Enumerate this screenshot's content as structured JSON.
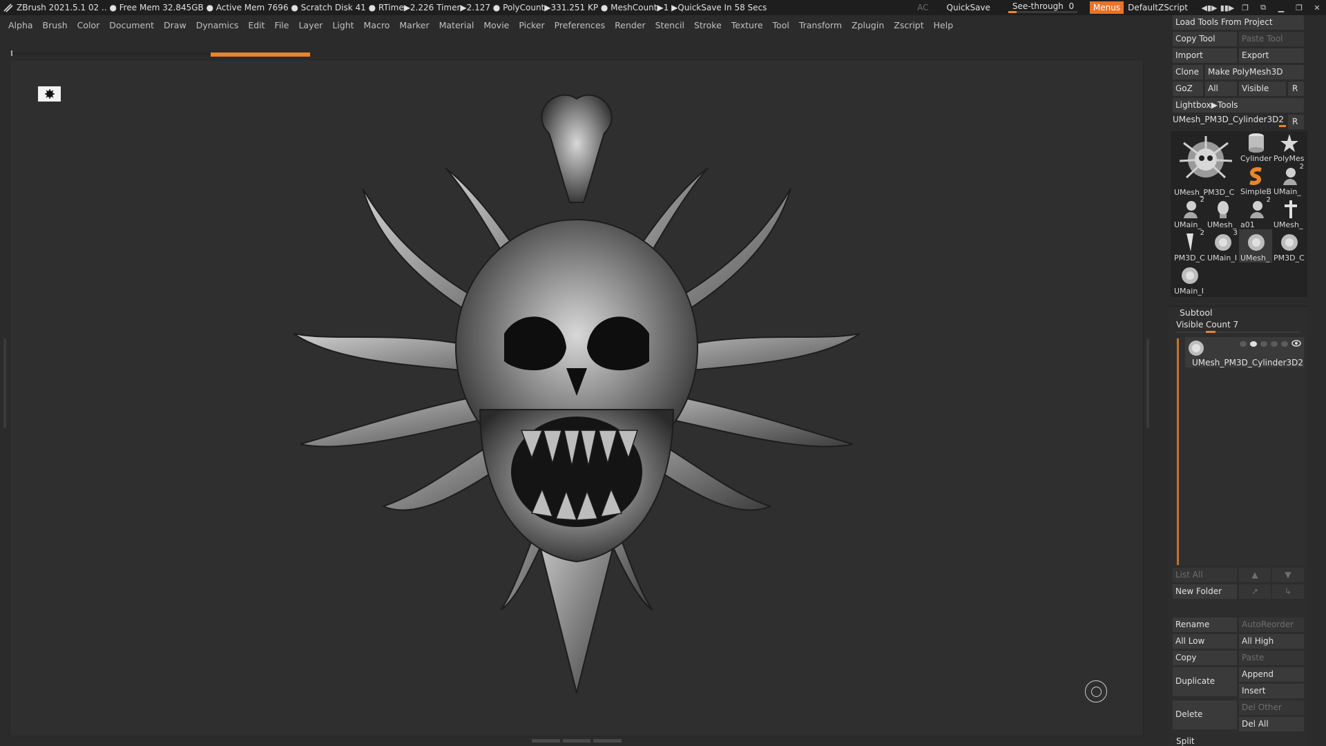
{
  "titlebar": {
    "status": "ZBrush 2021.5.1   02  .. ● Free Mem 32.845GB ● Active Mem 7696 ● Scratch Disk 41 ●  RTime▶2.226 Timer▶2.127 ● PolyCount▶331.251 KP  ● MeshCount▶1  ▶QuickSave In 58 Secs",
    "ac": "AC",
    "quicksave": "QuickSave",
    "seethrough_label": "See-through",
    "seethrough_value": "0",
    "menus": "Menus",
    "script": "DefaultZScript"
  },
  "menubar": {
    "items": [
      "Alpha",
      "Brush",
      "Color",
      "Document",
      "Draw",
      "Dynamics",
      "Edit",
      "File",
      "Layer",
      "Light",
      "Macro",
      "Marker",
      "Material",
      "Movie",
      "Picker",
      "Preferences",
      "Render",
      "Stencil",
      "Stroke",
      "Texture",
      "Tool",
      "Transform",
      "Zplugin",
      "Zscript",
      "Help"
    ]
  },
  "tool_panel": {
    "load_tools": "Load Tools From Project",
    "copy_tool": "Copy Tool",
    "paste_tool": "Paste Tool",
    "import": "Import",
    "export": "Export",
    "clone": "Clone",
    "make_polymesh": "Make PolyMesh3D",
    "goz": "GoZ",
    "all": "All",
    "visible": "Visible",
    "r": "R",
    "lightbox_tools": "Lightbox▶Tools",
    "current_tool": "UMesh_PM3D_Cylinder3D2",
    "tools": [
      {
        "label": "UMesh_PM3D_C",
        "count": ""
      },
      {
        "label": "Cylinder",
        "count": ""
      },
      {
        "label": "PolyMes",
        "count": ""
      },
      {
        "label": "SimpleB",
        "count": ""
      },
      {
        "label": "UMain_",
        "count": "2"
      },
      {
        "label": "UMain_",
        "count": "2"
      },
      {
        "label": "UMesh_",
        "count": ""
      },
      {
        "label": "a01",
        "count": "2"
      },
      {
        "label": "UMesh_",
        "count": ""
      },
      {
        "label": "PM3D_C",
        "count": "2"
      },
      {
        "label": "UMain_I",
        "count": "3"
      },
      {
        "label": "UMesh_",
        "count": ""
      },
      {
        "label": "PM3D_C",
        "count": ""
      },
      {
        "label": "UMain_I",
        "count": ""
      }
    ]
  },
  "subtool": {
    "title": "Subtool",
    "visible_count": "Visible Count 7",
    "item_name": "UMesh_PM3D_Cylinder3D2",
    "list_all": "List All",
    "new_folder": "New Folder",
    "rename": "Rename",
    "auto_reorder": "AutoReorder",
    "all_low": "All Low",
    "all_high": "All High",
    "copy": "Copy",
    "paste": "Paste",
    "duplicate": "Duplicate",
    "append": "Append",
    "insert": "Insert",
    "delete": "Delete",
    "del_other": "Del Other",
    "del_all": "Del All",
    "split": "Split"
  },
  "colors": {
    "accent": "#e8842a",
    "background": "#2b2b2b",
    "viewport": "#2f2f2f"
  }
}
